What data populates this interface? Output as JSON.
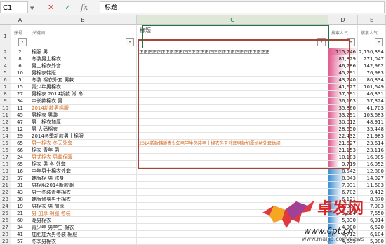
{
  "formula_bar": {
    "name_box": "C1",
    "fx_label": "fx",
    "formula_value": "标题",
    "cancel_icon": "x-icon",
    "enter_icon": "check-icon"
  },
  "columns": [
    "A",
    "B",
    "C",
    "D",
    "E"
  ],
  "header_row": {
    "a": "序号",
    "b": "关键词",
    "c": "标题",
    "d": "搜索人气",
    "e": "搜索人气"
  },
  "row2_c": "正正正正正正正正正正正正正正正正正正正正正正正正正正正正正正",
  "row18_c": "2014新款韩版青少年男学生冬装男士棉衣冬天外套男款加厚加绒外套休闲",
  "rows": [
    {
      "n": "2",
      "a": "2",
      "b": "棉服 男",
      "orange": false,
      "d": "715,746",
      "e": "2,150,394",
      "bar": 1.0,
      "barc": "#e05b8f"
    },
    {
      "n": "3",
      "a": "8",
      "b": "冬装男士棉衣",
      "orange": false,
      "d": "81,829",
      "e": "271,047",
      "bar": 0.6,
      "barc": "#e05b8f"
    },
    {
      "n": "4",
      "a": "6",
      "b": "男士棉衣外套",
      "orange": false,
      "d": "46,786",
      "e": "142,962",
      "bar": 0.55,
      "barc": "#e05b8f"
    },
    {
      "n": "5",
      "a": "10",
      "b": "男棉衣韩版",
      "orange": false,
      "d": "45,291",
      "e": "76,983",
      "bar": 0.55,
      "barc": "#e05b8f"
    },
    {
      "n": "6",
      "a": "5",
      "b": "冬装 棉衣外套 男款",
      "orange": false,
      "d": "43,740",
      "e": "80,834",
      "bar": 0.5,
      "barc": "#e05b8f"
    },
    {
      "n": "7",
      "a": "15",
      "b": "青少年男棉衣",
      "orange": false,
      "d": "41,627",
      "e": "101,649",
      "bar": 0.5,
      "barc": "#e05b8f"
    },
    {
      "n": "8",
      "a": "27",
      "b": "男棉衣 2014新款 潮 冬",
      "orange": false,
      "d": "37,591",
      "e": "46,331",
      "bar": 0.48,
      "barc": "#e05b8f"
    },
    {
      "n": "9",
      "a": "34",
      "b": "中长款棉衣 男",
      "orange": false,
      "d": "36,163",
      "e": "57,324",
      "bar": 0.48,
      "barc": "#e05b8f"
    },
    {
      "n": "10",
      "a": "11",
      "b": "2014新款男棉服",
      "orange": true,
      "d": "35,860",
      "e": "41,703",
      "bar": 0.47,
      "barc": "#e05b8f"
    },
    {
      "n": "11",
      "a": "45",
      "b": "男棉衣 男装",
      "orange": false,
      "d": "33,291",
      "e": "103,683",
      "bar": 0.45,
      "barc": "#e05b8f"
    },
    {
      "n": "12",
      "a": "47",
      "b": "男士棉衣加厚",
      "orange": false,
      "d": "30,012",
      "e": "48,911",
      "bar": 0.42,
      "barc": "#e05b8f"
    },
    {
      "n": "13",
      "a": "12",
      "b": "男 大码棉衣",
      "orange": false,
      "d": "28,650",
      "e": "35,448",
      "bar": 0.42,
      "barc": "#e05b8f"
    },
    {
      "n": "14",
      "a": "29",
      "b": "2014冬季新款男士棉服",
      "orange": false,
      "d": "22,432",
      "e": "21,983",
      "bar": 0.4,
      "barc": "#e05b8f"
    },
    {
      "n": "15",
      "a": "65",
      "b": "男士棉衣 冬天外套",
      "orange": true,
      "d": "21,627",
      "e": "23,614",
      "bar": 0.4,
      "barc": "#e05b8f"
    },
    {
      "n": "16",
      "a": "66",
      "b": "棉衣 青年 男",
      "orange": false,
      "d": "21,153",
      "e": "23,116",
      "bar": 0.38,
      "barc": "#e05b8f"
    },
    {
      "n": "17",
      "a": "24",
      "b": "男式棉衣 男装保暖",
      "orange": true,
      "d": "10,183",
      "e": "16,085",
      "bar": 0.35,
      "barc": "#e05b8f"
    },
    {
      "n": "18",
      "a": "65",
      "b": "棉衣 男 冬 外套",
      "orange": false,
      "d": "9,719",
      "e": "16,052",
      "bar": 0.35,
      "barc": "#e05b8f"
    },
    {
      "n": "19",
      "a": "16",
      "b": "中年男士棉衣外套",
      "orange": false,
      "d": "8,542",
      "e": "12,880",
      "bar": 0.6,
      "barc": "#3d8fd6"
    },
    {
      "n": "20",
      "a": "37",
      "b": "韩版棉 男 修身",
      "orange": false,
      "d": "8,043",
      "e": "14,027",
      "bar": 0.55,
      "barc": "#3d8fd6"
    },
    {
      "n": "21",
      "a": "31",
      "b": "男棉服2014新款潮",
      "orange": false,
      "d": "7,931",
      "e": "11,603",
      "bar": 0.5,
      "barc": "#3d8fd6"
    },
    {
      "n": "22",
      "a": "43",
      "b": "男士冬装青年棉衣",
      "orange": false,
      "d": "6,702",
      "e": "9,412",
      "bar": 0.45,
      "barc": "#3d8fd6"
    },
    {
      "n": "23",
      "a": "38",
      "b": "韩版修身男士棉衣",
      "orange": false,
      "d": "6,121",
      "e": "8,870",
      "bar": 0.45,
      "barc": "#3d8fd6"
    },
    {
      "n": "24",
      "a": "19",
      "b": "男棉衣 男 加厚",
      "orange": false,
      "d": "5,801",
      "e": "7,903",
      "bar": 0.4,
      "barc": "#3d8fd6"
    },
    {
      "n": "25",
      "a": "21",
      "b": "男 加厚 棉服 冬装",
      "orange": true,
      "d": "5,624",
      "e": "7,650",
      "bar": 0.4,
      "barc": "#3d8fd6"
    },
    {
      "n": "26",
      "a": "60",
      "b": "潮男棉衣",
      "orange": false,
      "d": "5,330",
      "e": "6,914",
      "bar": 0.38,
      "barc": "#3d8fd6"
    },
    {
      "n": "27",
      "a": "34",
      "b": "青少年 男学生 棉衣",
      "orange": false,
      "d": "4,980",
      "e": "6,520",
      "bar": 0.35,
      "barc": "#3d8fd6"
    },
    {
      "n": "28",
      "a": "41",
      "b": "加肥加大男冬装 棉服",
      "orange": false,
      "d": "4,712",
      "e": "6,104",
      "bar": 0.35,
      "barc": "#3d8fd6"
    },
    {
      "n": "29",
      "a": "57",
      "b": "冬季男棉衣",
      "orange": false,
      "d": "4,655",
      "e": "5,980",
      "bar": 0.32,
      "barc": "#3d8fd6"
    }
  ],
  "watermark": {
    "brand": "卓发网",
    "url": "www.6pt.cn",
    "url2": "www.maijia.com/news"
  }
}
